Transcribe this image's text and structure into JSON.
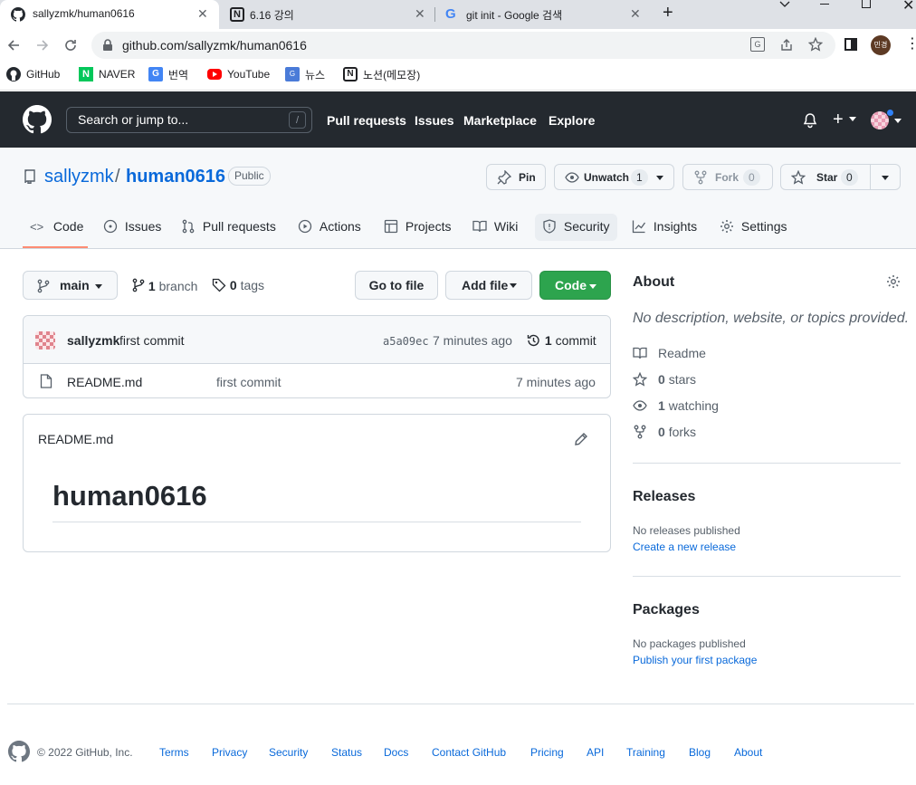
{
  "browser": {
    "tabs": [
      {
        "title": "sallyzmk/human0616"
      },
      {
        "title": "6.16 강의"
      },
      {
        "title": "git init - Google 검색"
      }
    ],
    "url": "github.com/sallyzmk/human0616",
    "profile_label": "민경",
    "bookmarks": [
      "GitHub",
      "NAVER",
      "번역",
      "YouTube",
      "뉴스",
      "노션(메모장)"
    ]
  },
  "gh": {
    "search_placeholder": "Search or jump to...",
    "search_key": "/",
    "nav": [
      "Pull requests",
      "Issues",
      "Marketplace",
      "Explore"
    ]
  },
  "repo": {
    "owner": "sallyzmk",
    "sep": "/",
    "name": "human0616",
    "visibility": "Public",
    "pin_label": "Pin",
    "unwatch_label": "Unwatch",
    "watch_count": "1",
    "fork_label": "Fork",
    "fork_count": "0",
    "star_label": "Star",
    "star_count": "0",
    "tabs": [
      "Code",
      "Issues",
      "Pull requests",
      "Actions",
      "Projects",
      "Wiki",
      "Security",
      "Insights",
      "Settings"
    ]
  },
  "files": {
    "branch": "main",
    "branch_count": "1",
    "branch_word": "branch",
    "tag_count": "0",
    "tag_word": "tags",
    "go_to_file": "Go to file",
    "add_file": "Add file",
    "code": "Code",
    "commit_author": "sallyzmk",
    "commit_msg": "first commit",
    "commit_hash": "a5a09ec",
    "commit_time": "7 minutes ago",
    "commit_count": "1",
    "commit_word": "commit",
    "rows": [
      {
        "name": "README.md",
        "message": "first commit",
        "time": "7 minutes ago"
      }
    ],
    "readme_title": "README.md",
    "readme_heading": "human0616"
  },
  "about": {
    "title": "About",
    "desc": "No description, website, or topics provided.",
    "readme": "Readme",
    "stars_n": "0",
    "stars_w": "stars",
    "watching_n": "1",
    "watching_w": "watching",
    "forks_n": "0",
    "forks_w": "forks",
    "releases_title": "Releases",
    "releases_none": "No releases published",
    "releases_link": "Create a new release",
    "packages_title": "Packages",
    "packages_none": "No packages published",
    "packages_link": "Publish your first package"
  },
  "footer": {
    "copyright": "© 2022 GitHub, Inc.",
    "links": [
      "Terms",
      "Privacy",
      "Security",
      "Status",
      "Docs",
      "Contact GitHub",
      "Pricing",
      "API",
      "Training",
      "Blog",
      "About"
    ]
  },
  "colors": {
    "accent": "#2da44e",
    "header": "#24292f",
    "link": "#0969da",
    "underline": "#fd8c73"
  }
}
